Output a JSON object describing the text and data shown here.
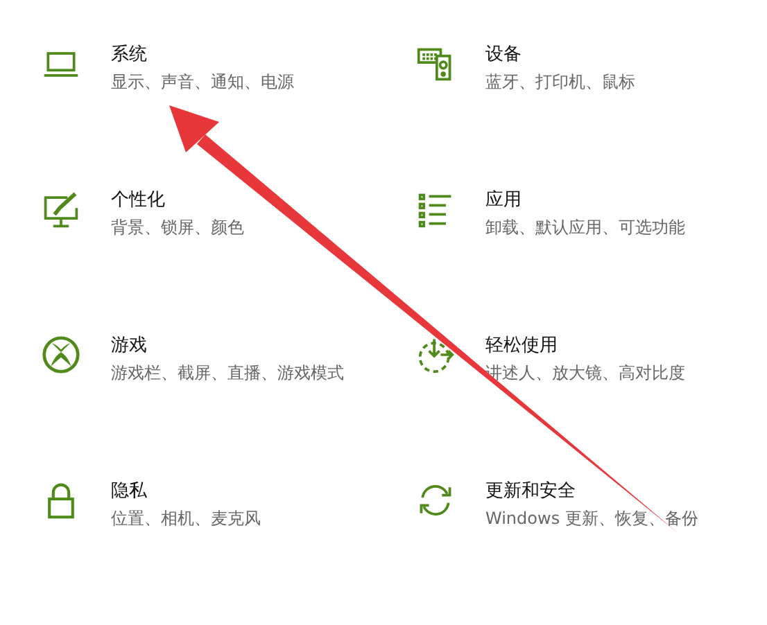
{
  "settings": [
    {
      "title": "系统",
      "subtitle": "显示、声音、通知、电源"
    },
    {
      "title": "设备",
      "subtitle": "蓝牙、打印机、鼠标"
    },
    {
      "title": "个性化",
      "subtitle": "背景、锁屏、颜色"
    },
    {
      "title": "应用",
      "subtitle": "卸载、默认应用、可选功能"
    },
    {
      "title": "游戏",
      "subtitle": "游戏栏、截屏、直播、游戏模式"
    },
    {
      "title": "轻松使用",
      "subtitle": "讲述人、放大镜、高对比度"
    },
    {
      "title": "隐私",
      "subtitle": "位置、相机、麦克风"
    },
    {
      "title": "更新和安全",
      "subtitle": "Windows 更新、恢复、备份"
    }
  ]
}
